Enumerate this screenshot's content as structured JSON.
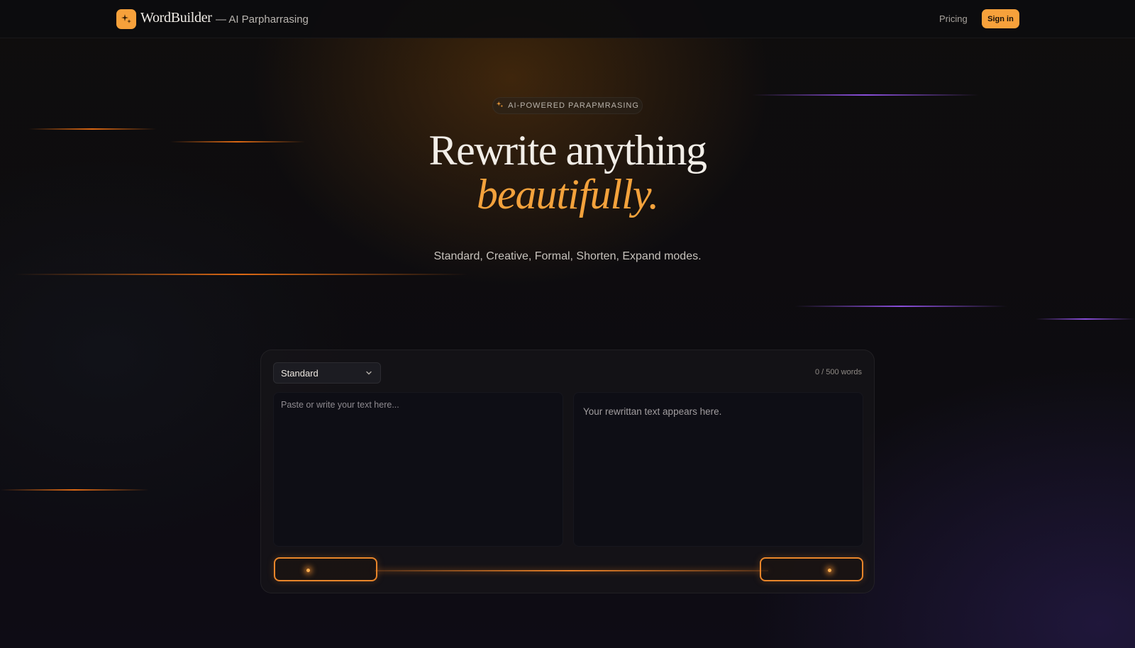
{
  "header": {
    "brand": "WordBuilder",
    "tagline": "— AI Parpharrasing",
    "nav_pricing": "Pricing",
    "signin_label": "Sign in",
    "logo_icon": "sparkle-icon"
  },
  "hero": {
    "badge": "AI-POWERED PARAPMRASING",
    "title_line1": "Rewrite anything",
    "title_line2": "beautifully.",
    "subtitle": "Standard, Creative, Formal, Shorten, Expand modes."
  },
  "editor": {
    "mode_selected": "Standard",
    "word_count": "0 / 500 words",
    "input_placeholder": "Paste or write your text here...",
    "output_placeholder": "Your rewrittan text appears here."
  },
  "colors": {
    "accent": "#f7a13b",
    "accent_italic": "#f4a23c",
    "background": "#0c0b0e"
  }
}
